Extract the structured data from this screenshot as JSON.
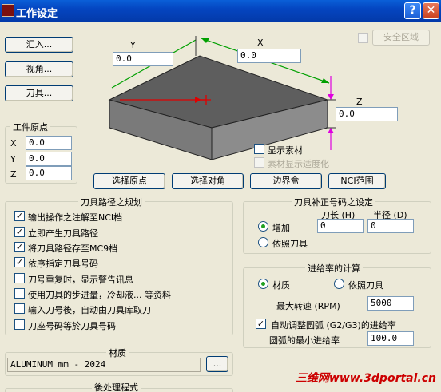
{
  "window": {
    "title": "工作设定",
    "help_label": "?",
    "close_label": "✕"
  },
  "left_buttons": {
    "import_label": "汇入...",
    "view_label": "视角...",
    "tool_label": "刀具..."
  },
  "safety_zone": {
    "label": "安全区域",
    "checked": false
  },
  "diagram": {
    "y_label": "Y",
    "y_value": "0.0",
    "x_label": "X",
    "x_value": "0.0",
    "z_label": "Z",
    "z_value": "0.0"
  },
  "workpiece_origin": {
    "title": "工件原点",
    "x_label": "X",
    "x_value": "0.0",
    "y_label": "Y",
    "y_value": "0.0",
    "z_label": "Z",
    "z_value": "0.0"
  },
  "display_options": {
    "show_material_label": "显示素材",
    "show_material_checked": false,
    "fit_screen_label": "素材显示适度化",
    "fit_screen_checked": false
  },
  "action_buttons": {
    "select_origin": "选择原点",
    "select_corner": "选择对角",
    "bounding_box": "边界盒",
    "nci_range": "NCI范围"
  },
  "toolpath_planning": {
    "title": "刀具路径之规划",
    "options": [
      {
        "label": "输出操作之注解至NCI档",
        "checked": true
      },
      {
        "label": "立即产生刀具路径",
        "checked": true
      },
      {
        "label": "将刀具路径存至MC9档",
        "checked": true
      },
      {
        "label": "依序指定刀具号码",
        "checked": true
      },
      {
        "label": "刀号重复时，显示警告讯息",
        "checked": false
      },
      {
        "label": "使用刀具的步进量，冷却液... 等资料",
        "checked": false
      },
      {
        "label": "输入刀号後，自动由刀具库取刀",
        "checked": false
      },
      {
        "label": "刀座号码等於刀具号码",
        "checked": false
      }
    ]
  },
  "tool_compensation": {
    "title": "刀具补正号码之设定",
    "length_header": "刀长 (H)",
    "radius_header": "半径 (D)",
    "increment_label": "增加",
    "increment_selected": true,
    "length_value": "0",
    "radius_value": "0",
    "by_tool_label": "依照刀具",
    "by_tool_selected": false
  },
  "feed_rate": {
    "title": "进给率的计算",
    "material_label": "材质",
    "material_selected": true,
    "by_tool_label": "依照刀具",
    "by_tool_selected": false,
    "max_speed_label": "最大转速 (RPM)",
    "max_speed_value": "5000",
    "auto_adjust_label": "自动调整圆弧 (G2/G3)的进给率",
    "auto_adjust_checked": true,
    "min_arc_label": "圆弧的最小进给率",
    "min_arc_value": "100.0"
  },
  "material": {
    "title": "材质",
    "value": "ALUMINUM mm - 2024",
    "browse_label": "..."
  },
  "post_processor": {
    "title": "後处理程式"
  },
  "watermark": "三维网www.3dportal.cn",
  "colors": {
    "title_bar": "#0445c0",
    "window_bg": "#ece9d8",
    "block_top": "#5e5e5e",
    "block_side": "#808080",
    "dim_arrow_green": "#00a000",
    "dim_arrow_magenta": "#e000e0",
    "origin_red": "#e00000"
  }
}
